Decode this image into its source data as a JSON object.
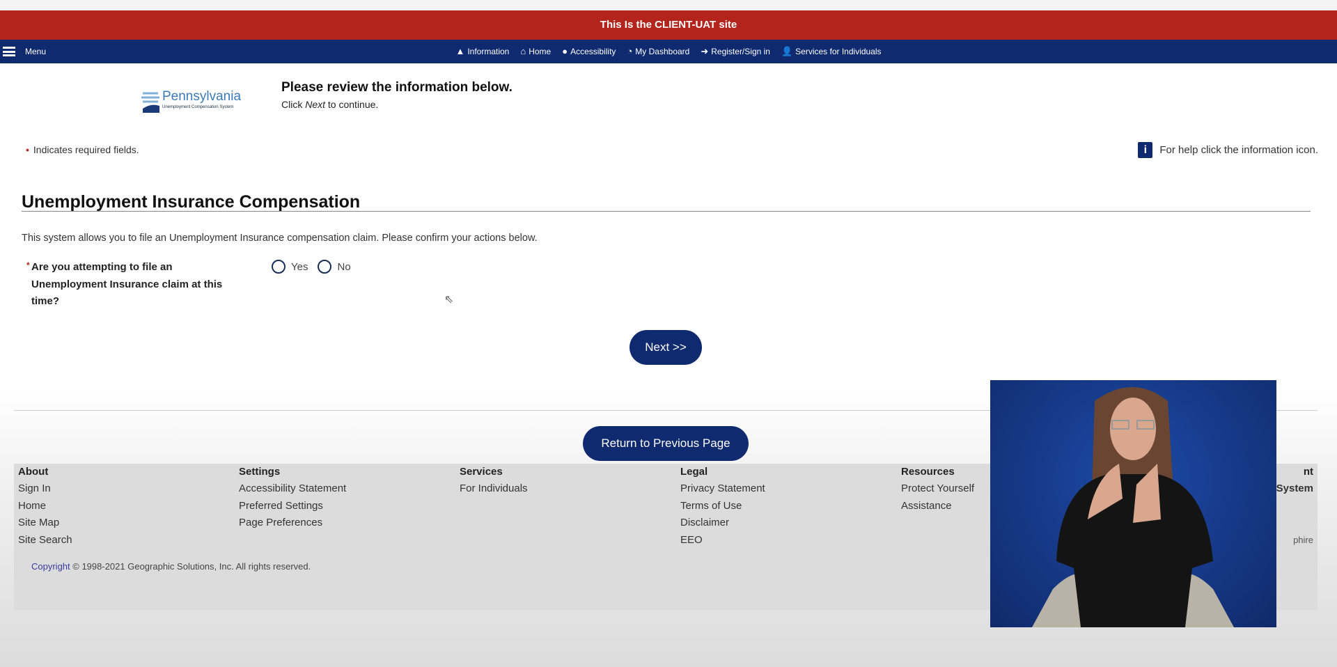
{
  "banner": {
    "text": "This Is the CLIENT-UAT site",
    "color": "#b3241c"
  },
  "nav": {
    "menu_label": "Menu",
    "color": "#0f2a6e",
    "items": [
      {
        "label": "Information",
        "icon": "warning-icon"
      },
      {
        "label": "Home",
        "icon": "home-icon"
      },
      {
        "label": "Accessibility",
        "icon": "accessibility-icon"
      },
      {
        "label": "My Dashboard",
        "icon": "dashboard-icon"
      },
      {
        "label": "Register/Sign in",
        "icon": "sign-in-icon"
      },
      {
        "label": "Services for Individuals",
        "icon": "user-icon"
      }
    ]
  },
  "logo": {
    "name": "Pennsylvania",
    "sub": "Unemployment Compensation System"
  },
  "header": {
    "title": "Please review the information below.",
    "sub_pre": "Click ",
    "sub_em": "Next",
    "sub_post": " to continue."
  },
  "required_note": "Indicates required fields.",
  "help_text": "For help click the information icon.",
  "section": {
    "title": "Unemployment Insurance Compensation",
    "description": "This system allows you to file an Unemployment Insurance compensation claim. Please confirm your actions below."
  },
  "question": {
    "label": "Are you attempting to file an Unemployment Insurance claim at this time?",
    "options": [
      "Yes",
      "No"
    ],
    "selected": null
  },
  "buttons": {
    "next": "Next >>",
    "back": "Return to Previous Page"
  },
  "footer": {
    "columns": [
      {
        "heading": "About",
        "links": [
          "Sign In",
          "Home",
          "Site Map",
          "Site Search"
        ]
      },
      {
        "heading": "Settings",
        "links": [
          "Accessibility Statement",
          "Preferred Settings",
          "Page Preferences"
        ]
      },
      {
        "heading": "Services",
        "links": [
          "For Individuals"
        ]
      },
      {
        "heading": "Legal",
        "links": [
          "Privacy Statement",
          "Terms of Use",
          "Disclaimer",
          "EEO"
        ]
      },
      {
        "heading": "Resources",
        "links": [
          "Protect Yourself",
          "Assistance"
        ]
      }
    ],
    "partial": {
      "heading": "nt",
      "item": "System",
      "bottom": "phire"
    },
    "copyright_link": "Copyright",
    "copyright_text": " © 1998-2021 Geographic Solutions, Inc. All rights reserved."
  }
}
